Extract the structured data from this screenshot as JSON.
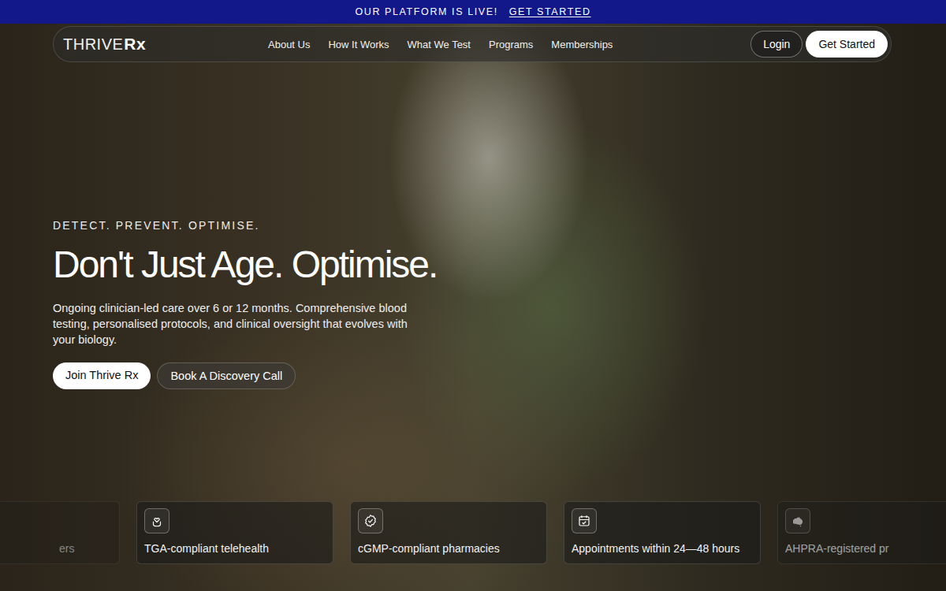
{
  "banner": {
    "text": "OUR PLATFORM IS LIVE!",
    "link": "GET STARTED"
  },
  "nav": {
    "logo": {
      "word": "THRIVE",
      "mark": "Rx"
    },
    "links": [
      "About Us",
      "How It Works",
      "What We Test",
      "Programs",
      "Memberships"
    ],
    "login": "Login",
    "cta": "Get Started"
  },
  "hero": {
    "eyebrow": "DETECT. PREVENT. OPTIMISE.",
    "title": "Don't Just Age. Optimise.",
    "body": "Ongoing clinician-led care over 6 or 12 months. Comprehensive blood testing, personalised protocols, and clinical oversight that evolves with your biology.",
    "primary": "Join Thrive Rx",
    "secondary": "Book A Discovery Call"
  },
  "features": [
    {
      "label": "ers"
    },
    {
      "label": "TGA-compliant telehealth"
    },
    {
      "label": "cGMP-compliant pharmacies"
    },
    {
      "label": "Appointments within 24—48 hours"
    },
    {
      "label": "AHPRA-registered pr"
    }
  ]
}
